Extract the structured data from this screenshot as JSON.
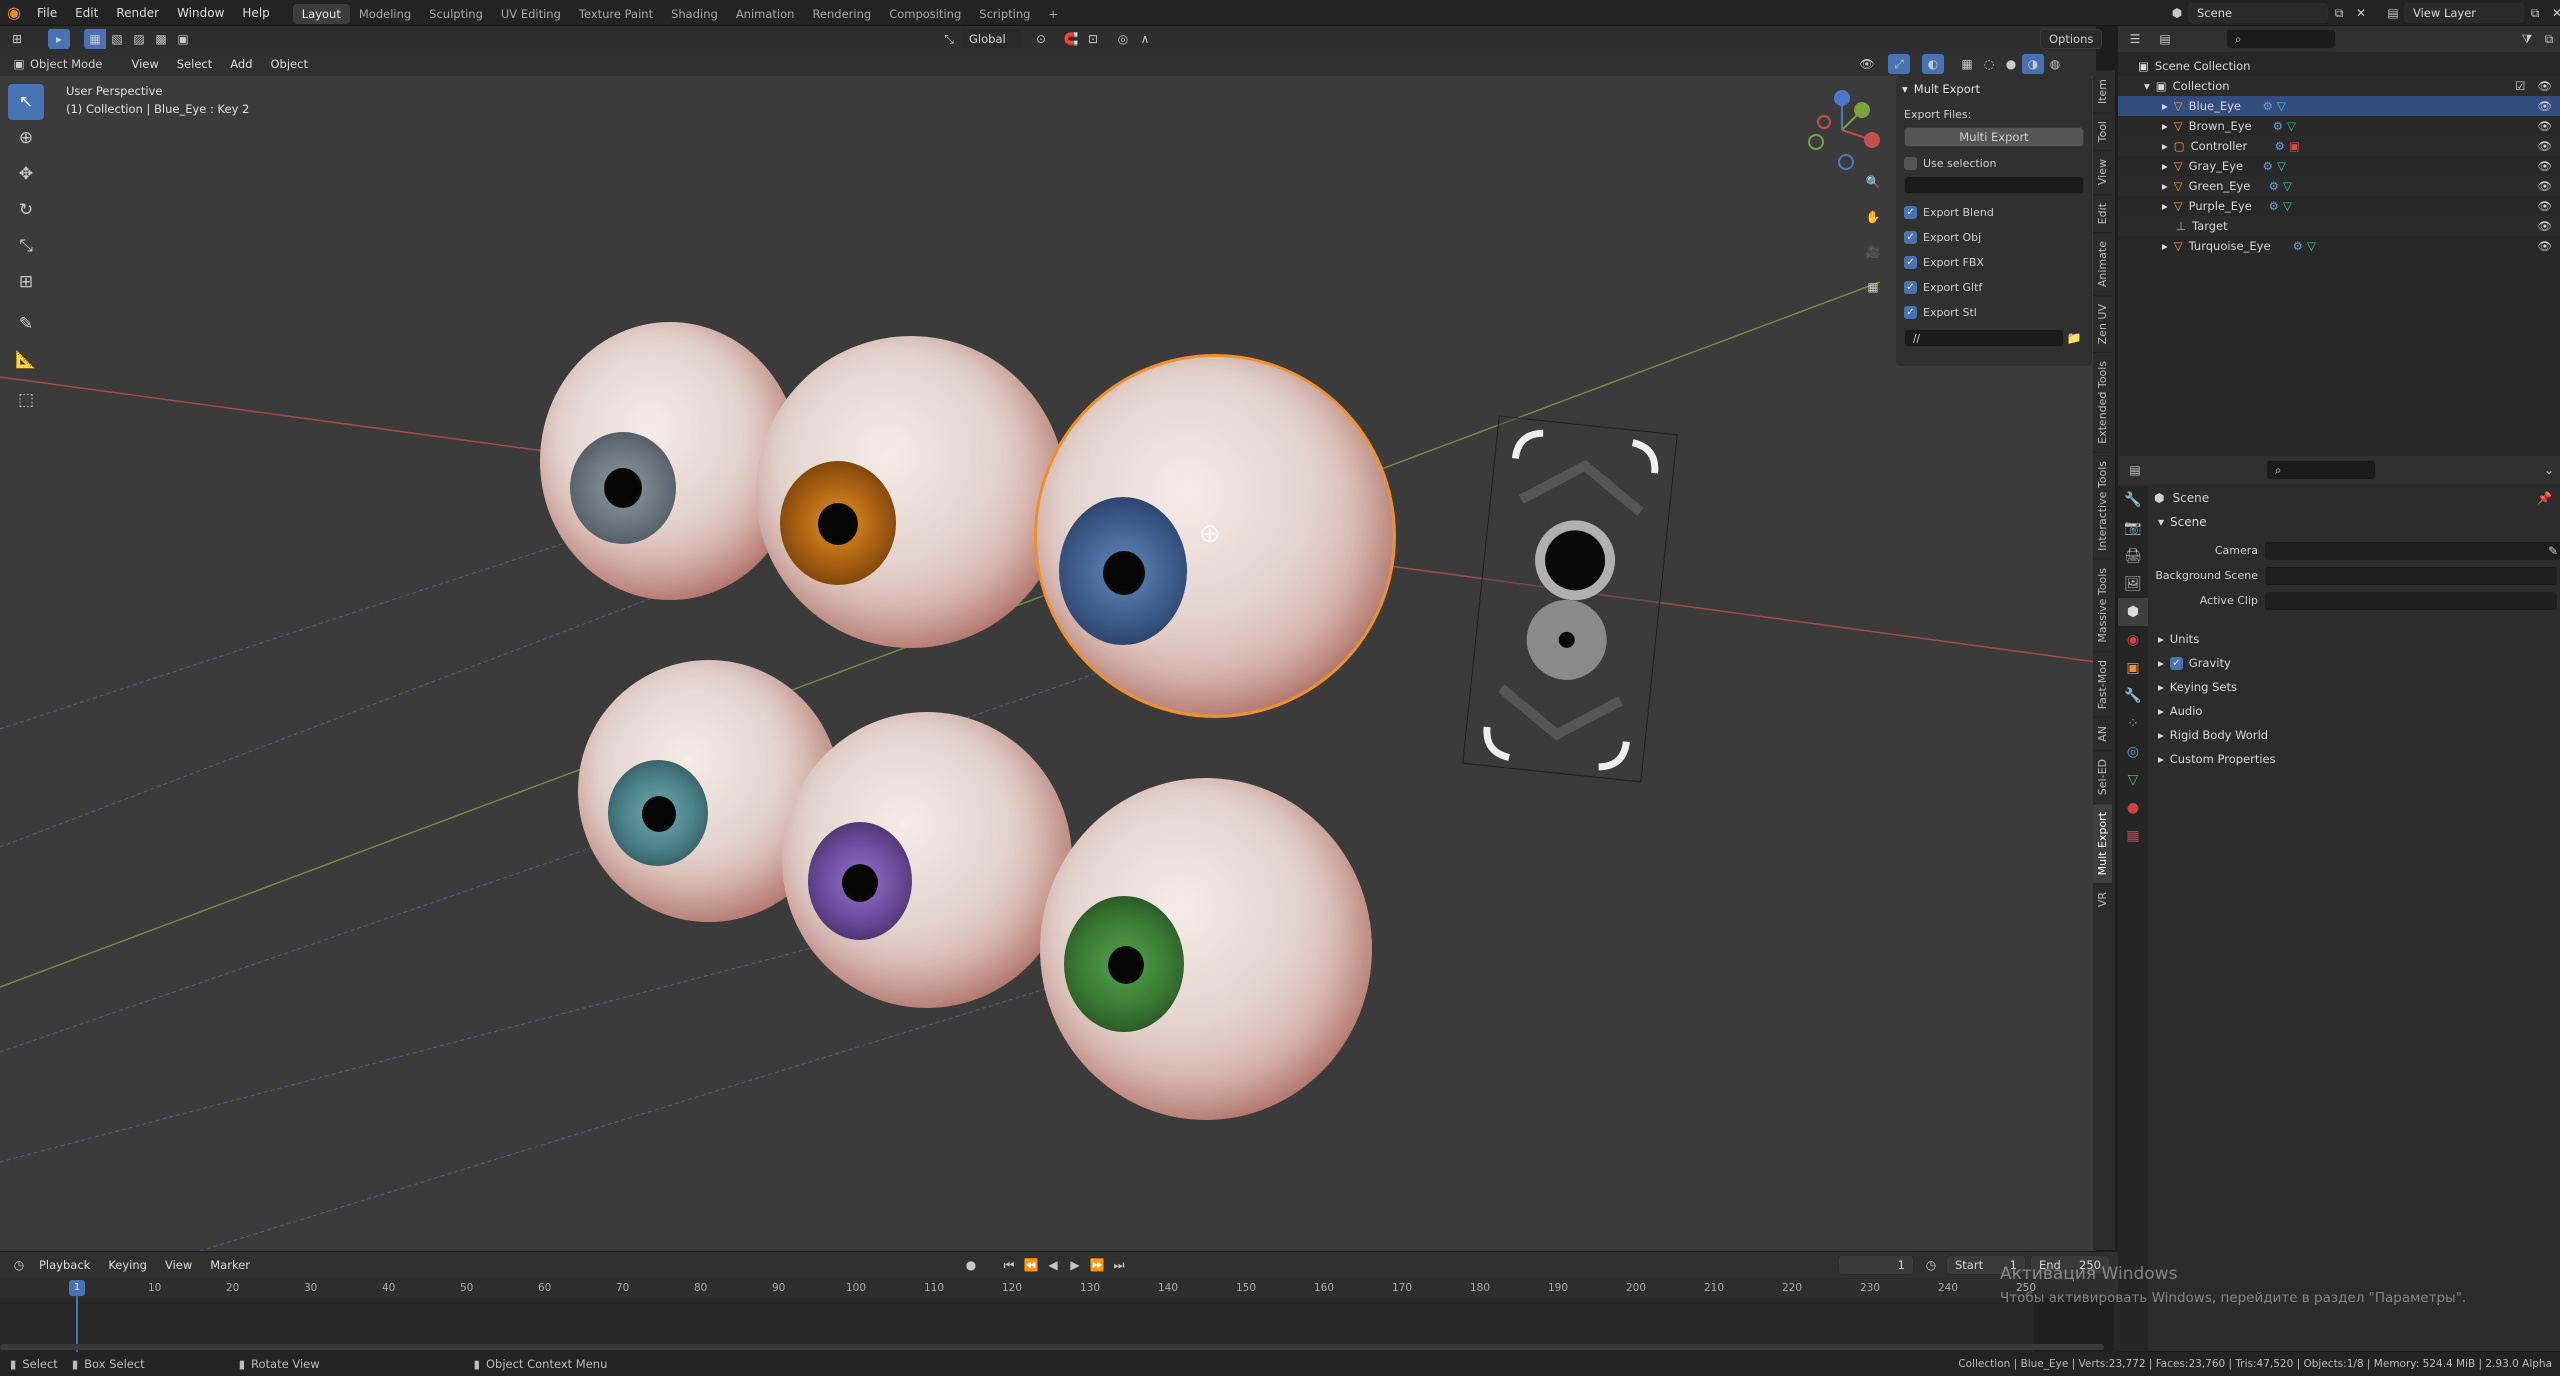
{
  "topbar": {
    "menus": [
      "File",
      "Edit",
      "Render",
      "Window",
      "Help"
    ],
    "workspaces": [
      "Layout",
      "Modeling",
      "Sculpting",
      "UV Editing",
      "Texture Paint",
      "Shading",
      "Animation",
      "Rendering",
      "Compositing",
      "Scripting"
    ],
    "active_workspace": "Layout",
    "add_tab": "+",
    "scene": "Scene",
    "view_layer": "View Layer"
  },
  "vp_header": {
    "mode": "Object Mode",
    "menus": [
      "View",
      "Select",
      "Add",
      "Object"
    ],
    "orientation": "Global",
    "options": "Options"
  },
  "viewport": {
    "perspective": "User Perspective",
    "context": "(1) Collection | Blue_Eye : Key 2"
  },
  "mult_export": {
    "title": "Mult Export",
    "export_files_label": "Export Files:",
    "button": "Multi Export",
    "use_selection": "Use selection",
    "options": [
      {
        "label": "Export Blend",
        "checked": true
      },
      {
        "label": "Export Obj",
        "checked": true
      },
      {
        "label": "Export FBX",
        "checked": true
      },
      {
        "label": "Export Gltf",
        "checked": true
      },
      {
        "label": "Export Stl",
        "checked": true
      }
    ],
    "path": "//"
  },
  "ntabs": [
    "Item",
    "Tool",
    "View",
    "Edit",
    "Animate",
    "Zen UV",
    "Extended Tools",
    "Interactive Tools",
    "Massive Tools",
    "Fast-Mod",
    "AN",
    "Sel-ED",
    "Mult Export",
    "VR"
  ],
  "ntab_active": "Mult Export",
  "outliner": {
    "root": "Scene Collection",
    "collection": "Collection",
    "items": [
      {
        "name": "Blue_Eye",
        "selected": true
      },
      {
        "name": "Brown_Eye",
        "selected": false
      },
      {
        "name": "Controller",
        "selected": false
      },
      {
        "name": "Gray_Eye",
        "selected": false
      },
      {
        "name": "Green_Eye",
        "selected": false
      },
      {
        "name": "Purple_Eye",
        "selected": false
      },
      {
        "name": "Target",
        "selected": false
      },
      {
        "name": "Turquoise_Eye",
        "selected": false
      }
    ]
  },
  "properties": {
    "header": "Scene",
    "section": "Scene",
    "fields": [
      {
        "label": "Camera",
        "value": ""
      },
      {
        "label": "Background Scene",
        "value": ""
      },
      {
        "label": "Active Clip",
        "value": ""
      }
    ],
    "subsections": [
      "Units",
      "Gravity",
      "Keying Sets",
      "Audio",
      "Rigid Body World",
      "Custom Properties"
    ]
  },
  "timeline": {
    "menus": [
      "Playback",
      "Keying",
      "View",
      "Marker"
    ],
    "current_frame": "1",
    "start_label": "Start",
    "start": "1",
    "end_label": "End",
    "end": "250",
    "ticks": [
      "1",
      "10",
      "20",
      "30",
      "40",
      "50",
      "60",
      "70",
      "80",
      "90",
      "100",
      "110",
      "120",
      "130",
      "140",
      "150",
      "160",
      "170",
      "180",
      "190",
      "200",
      "210",
      "220",
      "230",
      "240",
      "250"
    ]
  },
  "watermark": {
    "line1": "Активация Windows",
    "line2": "Чтобы активировать Windows, перейдите в раздел \"Параметры\"."
  },
  "statusbar": {
    "select": "Select",
    "box_select": "Box Select",
    "rotate": "Rotate View",
    "context_menu": "Object Context Menu",
    "stats": "Collection | Blue_Eye | Verts:23,772 | Faces:23,760 | Tris:47,520 | Objects:1/8 | Memory: 524.4 MiB | 2.93.0 Alpha"
  },
  "colors": {
    "accent": "#4772b3",
    "selection_outline": "#f0902a",
    "x_axis": "#c0504d",
    "y_axis": "#7aa23f",
    "z_axis": "#4a78c4"
  }
}
